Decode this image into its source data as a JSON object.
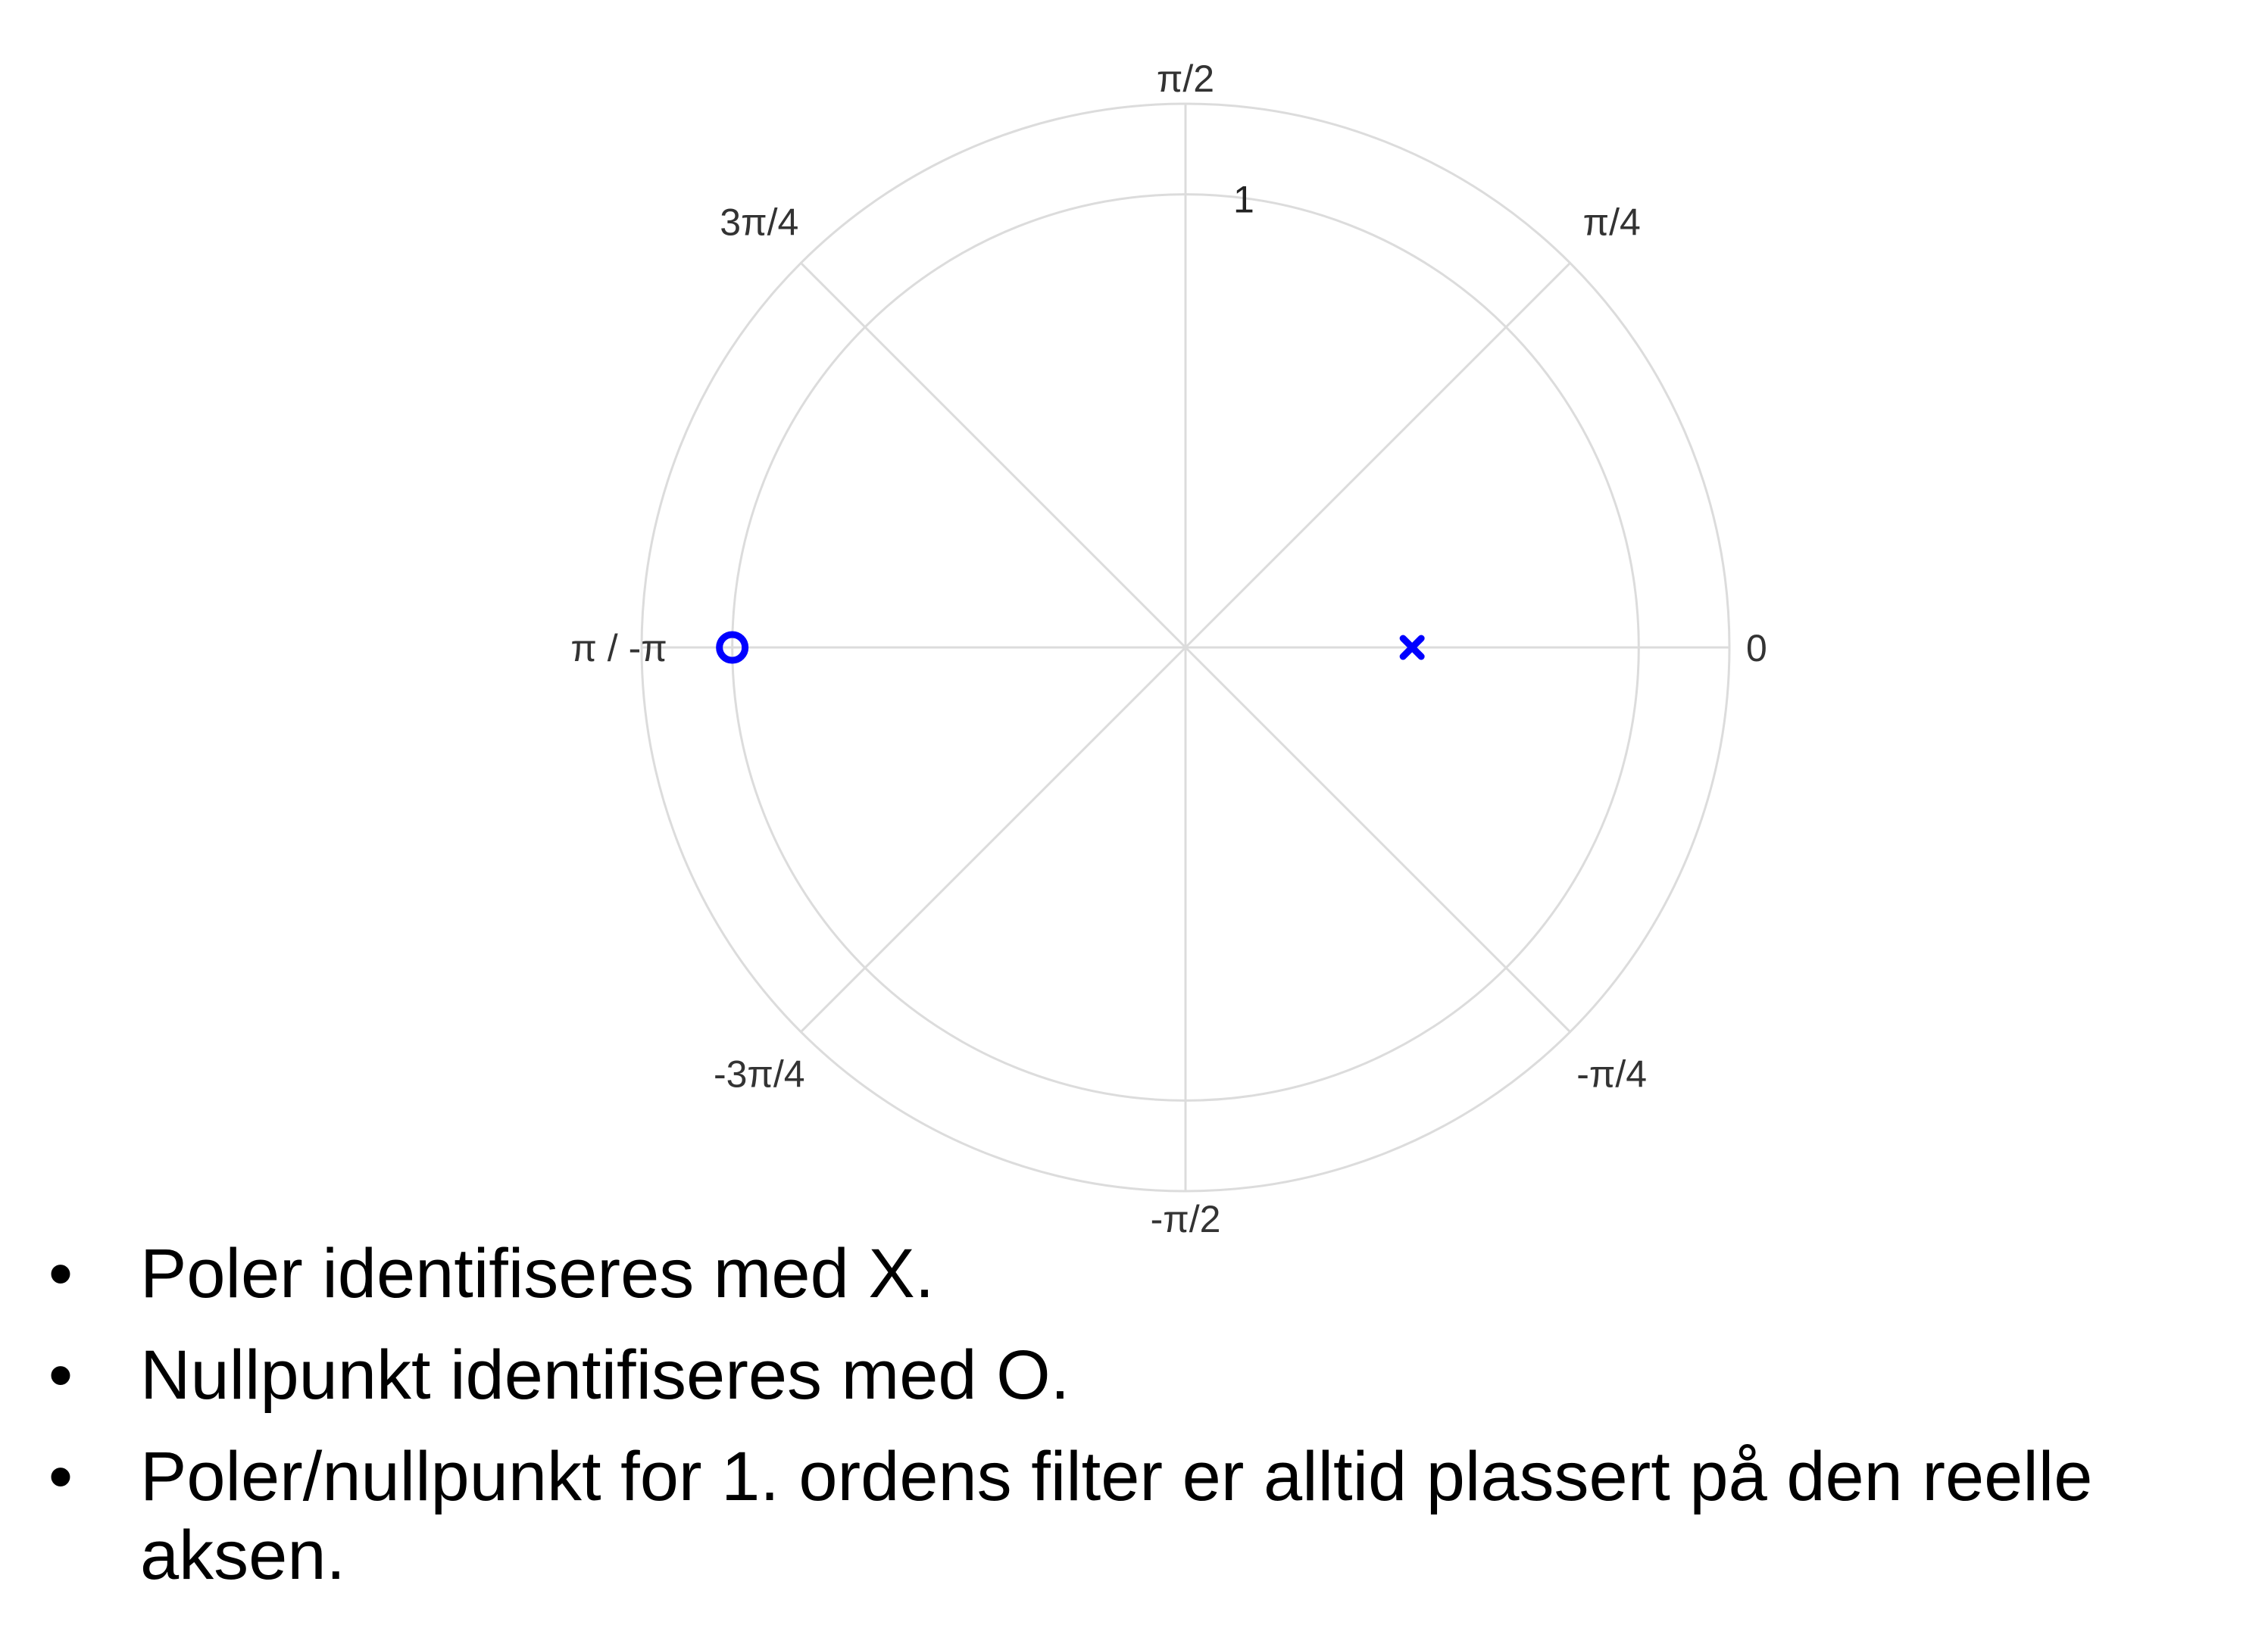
{
  "chart_data": {
    "type": "scatter",
    "coordinate_system": "polar",
    "title": "",
    "radial_ticks": [
      "1"
    ],
    "radial_max": 1.2,
    "angle_labels": [
      {
        "angle_deg": 0,
        "text": "0"
      },
      {
        "angle_deg": 45,
        "text": "π/4"
      },
      {
        "angle_deg": 90,
        "text": "π/2"
      },
      {
        "angle_deg": 135,
        "text": "3π/4"
      },
      {
        "angle_deg": 180,
        "text": "π / -π"
      },
      {
        "angle_deg": -135,
        "text": "-3π/4"
      },
      {
        "angle_deg": -90,
        "text": "-π/2"
      },
      {
        "angle_deg": -45,
        "text": "-π/4"
      }
    ],
    "circles": [
      1.0,
      1.2
    ],
    "grid": true,
    "series": [
      {
        "marker": "x",
        "color": "#0000ff",
        "points": [
          {
            "r": 0.5,
            "theta_deg": 0
          }
        ]
      },
      {
        "marker": "o",
        "color": "#0000ff",
        "points": [
          {
            "r": 1.0,
            "theta_deg": 180
          }
        ]
      }
    ]
  },
  "bullets": [
    "Poler identifiseres med X.",
    "Nullpunkt identifiseres med O.",
    "Poler/nullpunkt for 1. ordens filter er alltid plassert på den reelle aksen."
  ],
  "bullet_symbol": "•",
  "colors": {
    "grid": "#dcdcdc",
    "marker": "#0000ff",
    "text": "#000000"
  }
}
